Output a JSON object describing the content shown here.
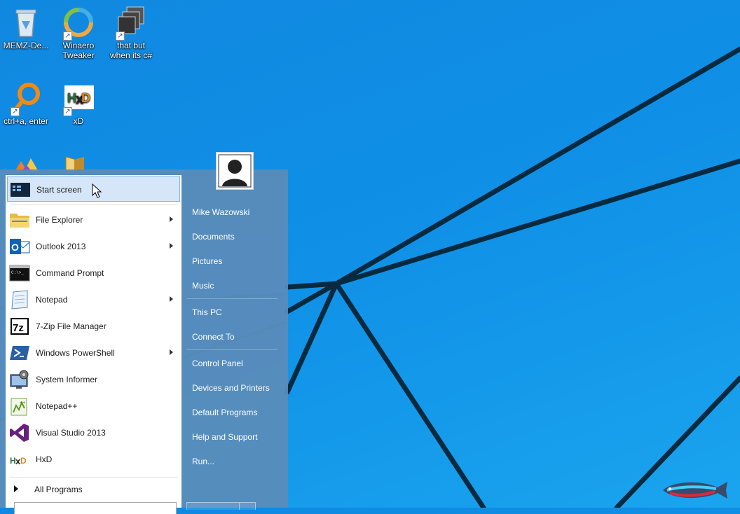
{
  "desktop": {
    "icons": [
      {
        "label": "MEMZ-De...",
        "icon": "recycle-bin-icon"
      },
      {
        "label": "Winaero\nTweaker",
        "icon": "winaero-tweaker-icon"
      },
      {
        "label": "that but\nwhen its c#",
        "icon": "stacked-windows-icon"
      },
      {
        "label": "ctrl+a, enter",
        "icon": "magnifier-icon"
      },
      {
        "label": "xD",
        "icon": "hxd-icon"
      }
    ]
  },
  "start_menu": {
    "pinned": [
      {
        "label": "Start screen",
        "icon": "start-screen-icon",
        "submenu": false,
        "highlighted": true
      },
      {
        "label": "File Explorer",
        "icon": "folder-icon",
        "submenu": true
      },
      {
        "label": "Outlook 2013",
        "icon": "outlook-icon",
        "submenu": true
      },
      {
        "label": "Command Prompt",
        "icon": "command-prompt-icon",
        "submenu": false
      },
      {
        "label": "Notepad",
        "icon": "notepad-icon",
        "submenu": true
      },
      {
        "label": "7-Zip File Manager",
        "icon": "7zip-icon",
        "submenu": false
      },
      {
        "label": "Windows PowerShell",
        "icon": "powershell-icon",
        "submenu": true
      },
      {
        "label": "System Informer",
        "icon": "system-informer-icon",
        "submenu": false
      },
      {
        "label": "Notepad++",
        "icon": "notepadpp-icon",
        "submenu": false
      },
      {
        "label": "Visual Studio 2013",
        "icon": "visual-studio-icon",
        "submenu": false
      },
      {
        "label": "HxD",
        "icon": "hxd-icon",
        "submenu": false
      }
    ],
    "all_programs": "All Programs",
    "right_pane": {
      "user_name": "Mike Wazowski",
      "group1": [
        "Documents",
        "Pictures",
        "Music"
      ],
      "group2": [
        "This PC",
        "Connect To"
      ],
      "group3": [
        "Control Panel",
        "Devices and Printers",
        "Default Programs",
        "Help and Support",
        "Run..."
      ]
    }
  },
  "colors": {
    "desktop_bg": "#1188e0",
    "start_menu_bg": "#5a8cb9",
    "highlight": "#d4e6f7"
  }
}
